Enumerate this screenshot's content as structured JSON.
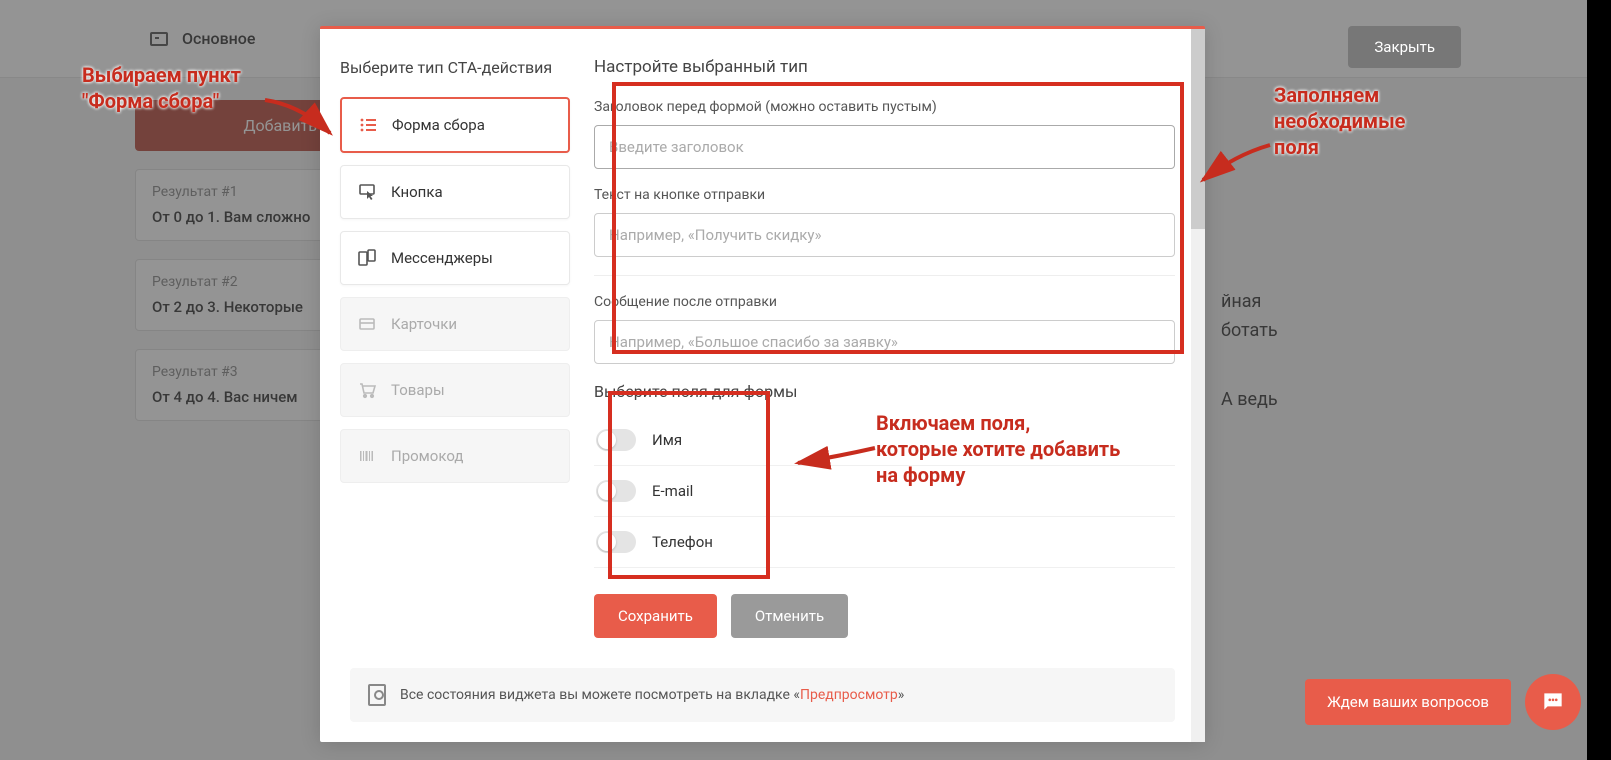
{
  "bg": {
    "header_title": "Основное",
    "close_btn": "Закрыть",
    "add_btn": "Добавить рез",
    "results": [
      {
        "title": "Результат #1",
        "text": "От 0 до 1.  Вам сложно"
      },
      {
        "title": "Результат #2",
        "text": "От 2 до 3.  Некоторые"
      },
      {
        "title": "Результат #3",
        "text": "От 4 до 4.  Вас ничем"
      }
    ],
    "right_lines": [
      "йная",
      "ботать",
      "",
      "А ведь"
    ]
  },
  "modal": {
    "left_title": "Выберите тип CTA-действия",
    "options": [
      {
        "label": "Форма сбора",
        "icon": "list-icon",
        "state": "active"
      },
      {
        "label": "Кнопка",
        "icon": "tap-icon",
        "state": "normal"
      },
      {
        "label": "Мессенджеры",
        "icon": "devices-icon",
        "state": "normal"
      },
      {
        "label": "Карточки",
        "icon": "cards-icon",
        "state": "disabled"
      },
      {
        "label": "Товары",
        "icon": "cart-icon",
        "state": "disabled"
      },
      {
        "label": "Промокод",
        "icon": "barcode-icon",
        "state": "disabled"
      }
    ],
    "right_title": "Настройте выбранный тип",
    "groups": [
      {
        "label": "Заголовок перед формой (можно оставить пустым)",
        "placeholder": "Введите заголовок",
        "focused": true
      },
      {
        "label": "Текст на кнопке отправки",
        "placeholder": "Например, «Получить скидку»",
        "focused": false
      },
      {
        "label": "Сообщение после отправки",
        "placeholder": "Например, «Большое спасибо за заявку»",
        "focused": false
      }
    ],
    "fields_title": "Выберите поля для формы",
    "fields": [
      {
        "label": "Имя"
      },
      {
        "label": "E-mail"
      },
      {
        "label": "Телефон"
      }
    ],
    "save": "Сохранить",
    "cancel": "Отменить",
    "info_text": "Все состояния виджета вы можете посмотреть на вкладке «",
    "info_link": "Предпросмотр",
    "info_suffix": "»"
  },
  "annotations": {
    "a1_l1": "Выбираем пункт",
    "a1_l2": "\"Форма сбора\"",
    "a2_l1": "Заполняем",
    "a2_l2": "необходимые",
    "a2_l3": "поля",
    "a3_l1": "Включаем поля,",
    "a3_l2": "которые хотите добавить",
    "a3_l3": "на форму"
  },
  "chat": {
    "label": "Ждем ваших вопросов"
  }
}
